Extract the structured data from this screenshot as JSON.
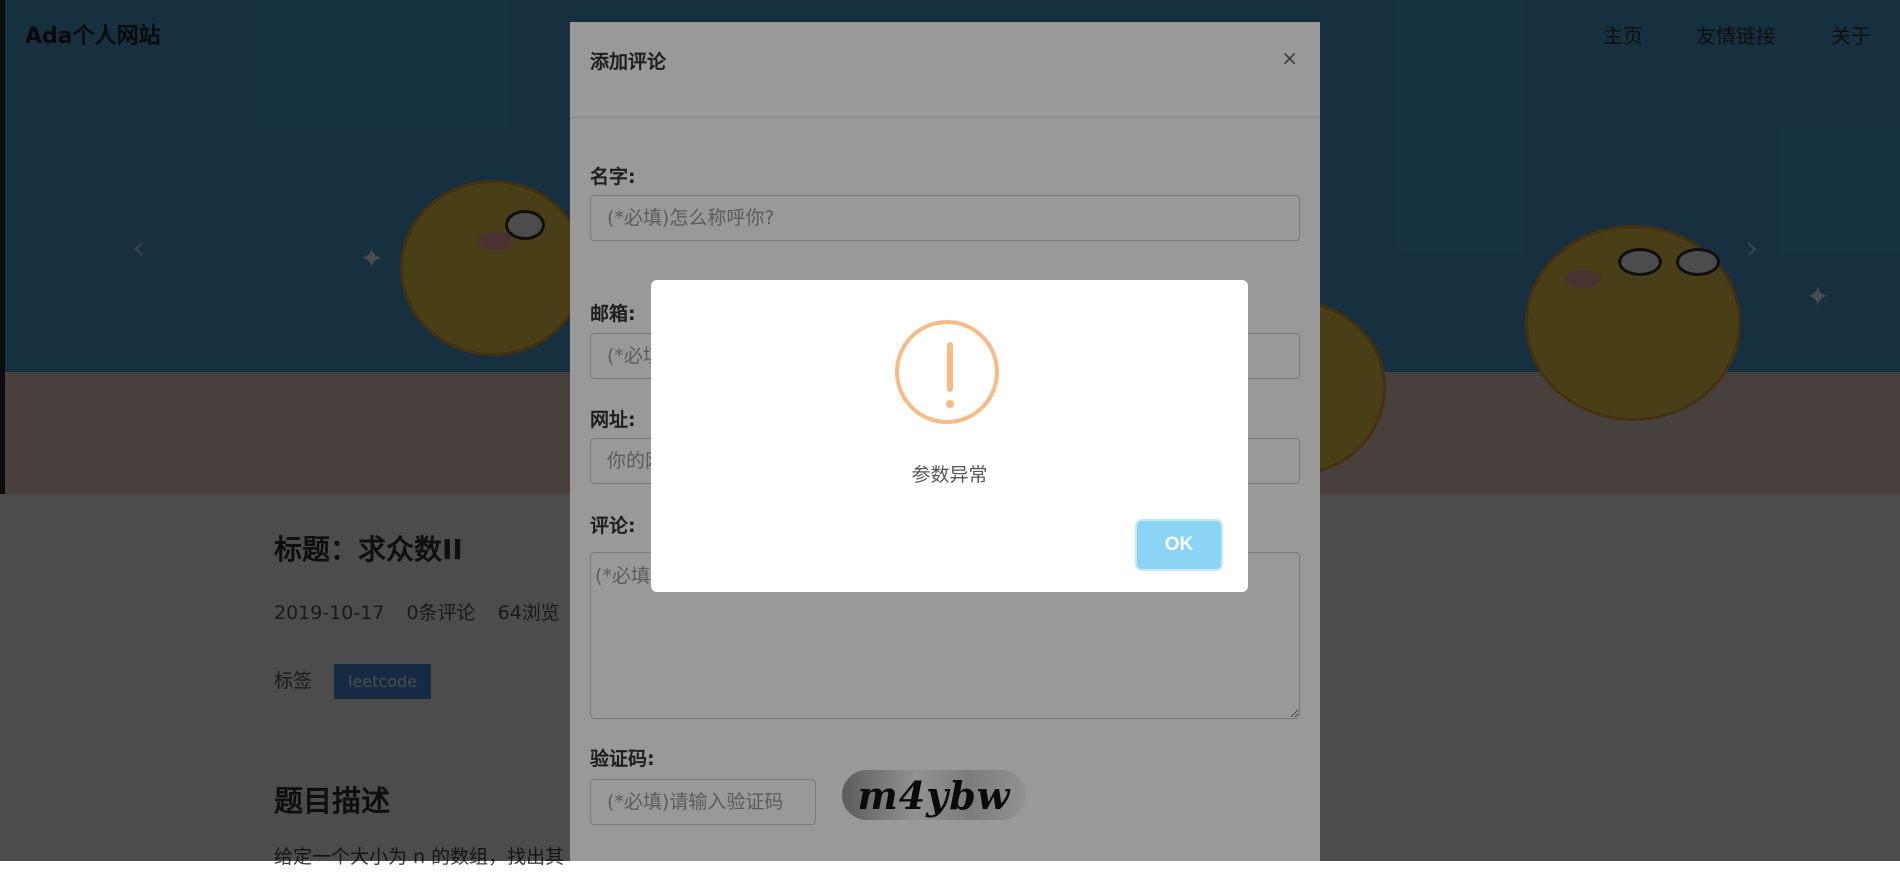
{
  "site": {
    "brand": "Ada个人网站",
    "nav": [
      "主页",
      "友情链接",
      "关于"
    ]
  },
  "article": {
    "title": "标题：求众数II",
    "date": "2019-10-17",
    "comments": "0条评论",
    "views": "64浏览",
    "tag_label": "标签",
    "tag": "leetcode",
    "section_title": "题目描述",
    "paragraph": "给定一个大小为 n 的数组，找出其"
  },
  "comment_modal": {
    "title": "添加评论",
    "close": "×",
    "name_label": "名字:",
    "name_placeholder": "(*必填)怎么称呼你?",
    "email_label": "邮箱:",
    "email_placeholder": "(*必填)",
    "url_label": "网址:",
    "url_placeholder": "你的网址",
    "comment_label": "评论:",
    "comment_placeholder": "(*必填)",
    "captcha_label": "验证码:",
    "captcha_placeholder": "(*必填)请输入验证码",
    "captcha_text": "m4ybw"
  },
  "alert": {
    "icon": "warning-icon",
    "message": "参数异常",
    "ok_label": "OK",
    "icon_color": "#f8bb86",
    "button_color": "#8cd4f5"
  }
}
